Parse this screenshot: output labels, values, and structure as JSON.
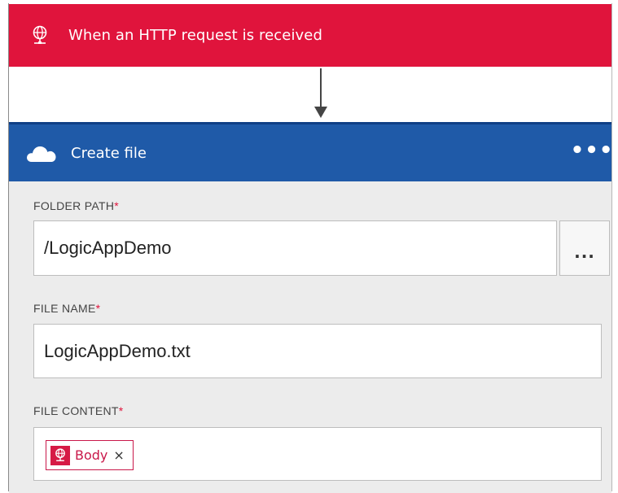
{
  "trigger": {
    "title": "When an HTTP request is received",
    "icon": "globe-request-icon",
    "color": "#e0143c"
  },
  "action": {
    "title": "Create file",
    "icon": "onedrive-cloud-icon",
    "more_label": "•••",
    "header_color": "#1f5aa8",
    "fields": {
      "folder_path": {
        "label": "FOLDER PATH",
        "required_mark": "*",
        "value": "/LogicAppDemo",
        "browse_label": "..."
      },
      "file_name": {
        "label": "FILE NAME",
        "required_mark": "*",
        "value": "LogicAppDemo.txt"
      },
      "file_content": {
        "label": "FILE CONTENT",
        "required_mark": "*",
        "token": {
          "label": "Body",
          "remove_label": "×",
          "icon": "globe-request-icon"
        }
      }
    }
  }
}
